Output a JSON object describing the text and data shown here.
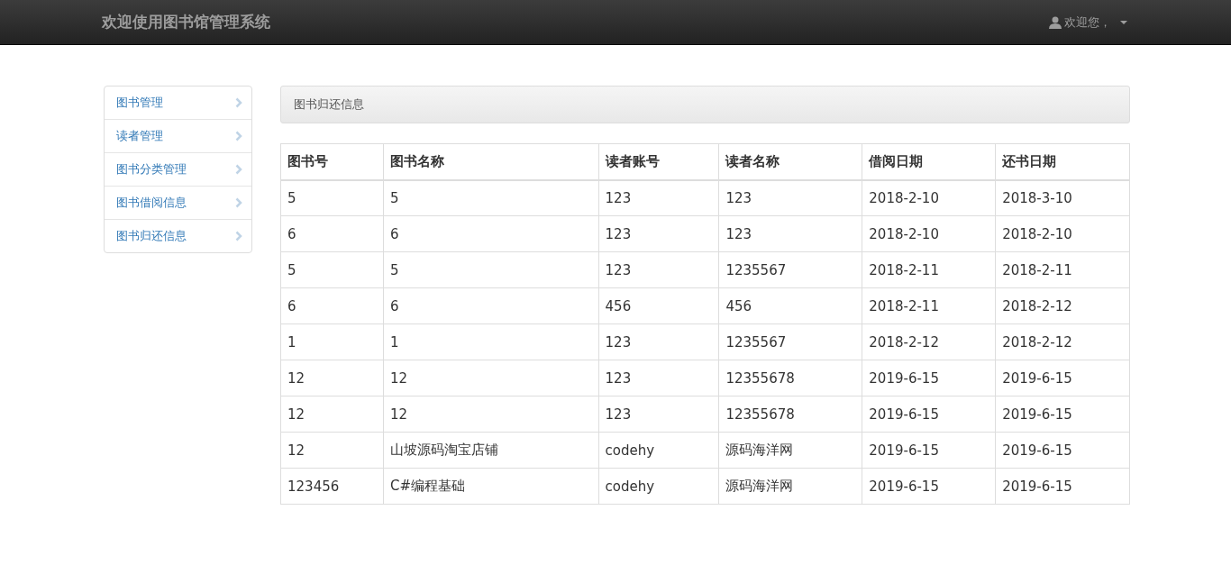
{
  "navbar": {
    "brand": "欢迎使用图书馆管理系统",
    "user_menu": "欢迎您，"
  },
  "sidebar": {
    "items": [
      {
        "label": "图书管理"
      },
      {
        "label": "读者管理"
      },
      {
        "label": "图书分类管理"
      },
      {
        "label": "图书借阅信息"
      },
      {
        "label": "图书归还信息"
      }
    ]
  },
  "panel": {
    "title": "图书归还信息"
  },
  "table": {
    "columns": [
      "图书号",
      "图书名称",
      "读者账号",
      "读者名称",
      "借阅日期",
      "还书日期"
    ],
    "rows": [
      [
        "5",
        "5",
        "123",
        "123",
        "2018-2-10",
        "2018-3-10"
      ],
      [
        "6",
        "6",
        "123",
        "123",
        "2018-2-10",
        "2018-2-10"
      ],
      [
        "5",
        "5",
        "123",
        "1235567",
        "2018-2-11",
        "2018-2-11"
      ],
      [
        "6",
        "6",
        "456",
        "456",
        "2018-2-11",
        "2018-2-12"
      ],
      [
        "1",
        "1",
        "123",
        "1235567",
        "2018-2-12",
        "2018-2-12"
      ],
      [
        "12",
        "12",
        "123",
        "12355678",
        "2019-6-15",
        "2019-6-15"
      ],
      [
        "12",
        "12",
        "123",
        "12355678",
        "2019-6-15",
        "2019-6-15"
      ],
      [
        "12",
        "山坡源码淘宝店铺",
        "codehy",
        "源码海洋网",
        "2019-6-15",
        "2019-6-15"
      ],
      [
        "123456",
        "C#编程基础",
        "codehy",
        "源码海洋网",
        "2019-6-15",
        "2019-6-15"
      ]
    ]
  }
}
